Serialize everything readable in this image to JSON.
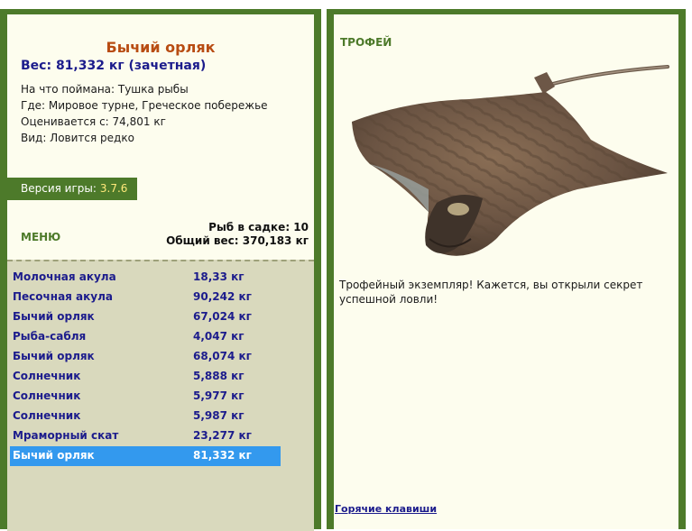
{
  "info": {
    "title": "Бычий орляк",
    "weight": "Вес: 81,332 кг (зачетная)",
    "lines": [
      "На что поймана: Тушка рыбы",
      "Где: Мировое турне, Греческое побережье",
      "Оценивается с: 74,801 кг",
      "Вид: Ловится редко"
    ]
  },
  "version": {
    "label": "Версия игры:",
    "value": "3.7.6"
  },
  "menu": {
    "label": "МЕНЮ"
  },
  "stats": {
    "count": "Рыб в садке: 10",
    "total": "Общий вес: 370,183 кг"
  },
  "catches": [
    {
      "name": "Молочная акула",
      "weight": "18,33 кг"
    },
    {
      "name": "Песочная акула",
      "weight": "90,242 кг"
    },
    {
      "name": "Бычий орляк",
      "weight": "67,024 кг"
    },
    {
      "name": "Рыба-сабля",
      "weight": "4,047 кг"
    },
    {
      "name": "Бычий орляк",
      "weight": "68,074 кг"
    },
    {
      "name": "Солнечник",
      "weight": "5,888 кг"
    },
    {
      "name": "Солнечник",
      "weight": "5,977 кг"
    },
    {
      "name": "Солнечник",
      "weight": "5,987 кг"
    },
    {
      "name": "Мраморный скат",
      "weight": "23,277 кг"
    },
    {
      "name": "Бычий орляк",
      "weight": "81,332 кг",
      "selected": true
    }
  ],
  "trophy": {
    "label": "ТРОФЕЙ",
    "text": "Трофейный экземпляр! Кажется, вы открыли секрет успешной ловли!",
    "image_icon": "eagle-ray-image"
  },
  "hotkeys": {
    "label": "Горячие клавиши"
  },
  "colors": {
    "frame": "#4d7a2a",
    "panel": "#fdfdee",
    "list": "#d9d9bd",
    "selected": "#3399ee",
    "title": "#b84c12"
  }
}
